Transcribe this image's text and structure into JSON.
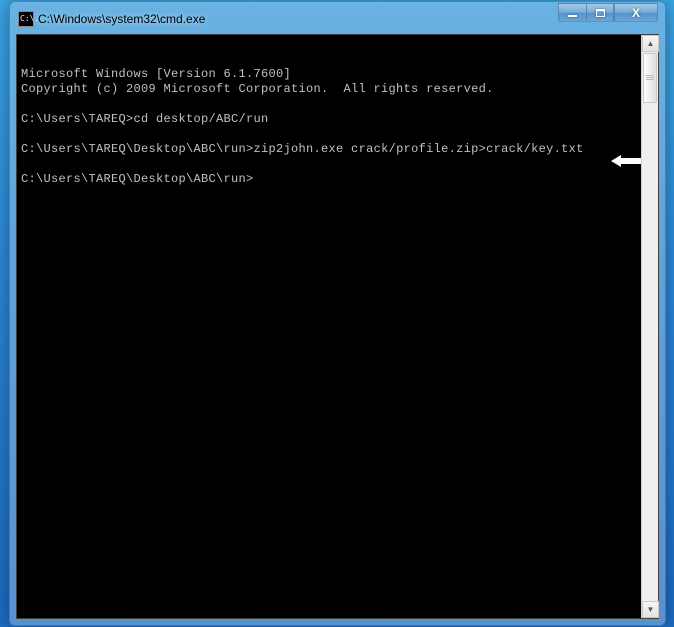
{
  "titlebar": {
    "icon_text": "C:\\.",
    "title": "C:\\Windows\\system32\\cmd.exe"
  },
  "terminal": {
    "banner_line_1": "Microsoft Windows [Version 6.1.7600]",
    "banner_line_2": "Copyright (c) 2009 Microsoft Corporation.  All rights reserved.",
    "lines": [
      {
        "prompt": "C:\\Users\\TAREQ>",
        "command": "cd desktop/ABC/run"
      },
      {
        "prompt": "C:\\Users\\TAREQ\\Desktop\\ABC\\run>",
        "command": "zip2john.exe crack/profile.zip>crack/key.txt"
      },
      {
        "prompt": "C:\\Users\\TAREQ\\Desktop\\ABC\\run>",
        "command": ""
      }
    ]
  },
  "window_controls": {
    "minimize": "_",
    "maximize": "▢",
    "close": "X"
  },
  "scrollbar": {
    "up": "▲",
    "down": "▼"
  }
}
